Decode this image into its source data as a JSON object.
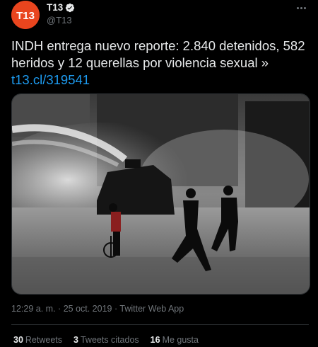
{
  "author": {
    "name": "T13",
    "handle": "@T13",
    "avatar_text": "T13",
    "avatar_color": "#e9451e",
    "verified": true
  },
  "tweet": {
    "text": "INDH entrega nuevo reporte: 2.840 detenidos, 582 heridos y 12 querellas por violencia sexual »",
    "link": "t13.cl/319541",
    "image_description": "Protest scene with water cannon and people running"
  },
  "meta": {
    "time": "12:29 a. m.",
    "separator": "·",
    "date": "25 oct. 2019",
    "source": "Twitter Web App"
  },
  "stats": [
    {
      "count": "30",
      "label": "Retweets"
    },
    {
      "count": "3",
      "label": "Tweets citados"
    },
    {
      "count": "16",
      "label": "Me gusta"
    }
  ],
  "colors": {
    "accent": "#1d9bf0",
    "background": "#000000",
    "verified": "#1d9bf0"
  },
  "icons": [
    "more-icon",
    "verified-icon"
  ]
}
